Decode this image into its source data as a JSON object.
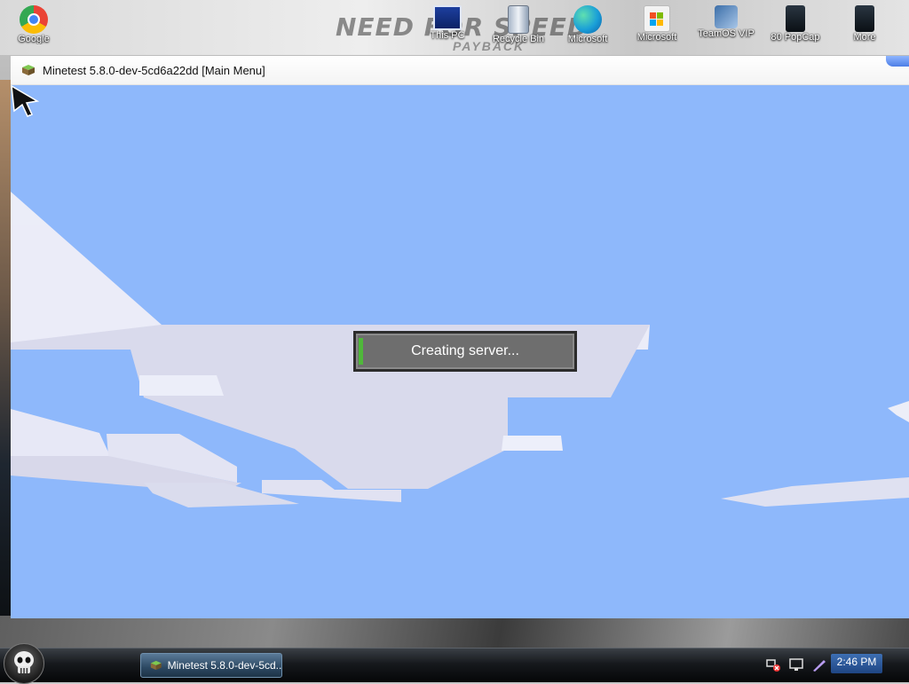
{
  "desktop": {
    "wallpaper_logo": "NEED FOR SPEED",
    "wallpaper_sub": "PAYBACK",
    "icons": [
      {
        "label": "Google",
        "icon": "chrome-icon"
      },
      {
        "label": "This PC",
        "icon": "computer-icon"
      },
      {
        "label": "Recycle Bin",
        "icon": "recycle-bin-icon"
      },
      {
        "label": "Microsoft",
        "icon": "edge-icon"
      },
      {
        "label": "Microsoft",
        "icon": "store-icon"
      },
      {
        "label": "TeamOS VIP",
        "icon": "teamos-icon"
      },
      {
        "label": "80 PopCap",
        "icon": "popcap-icon"
      },
      {
        "label": "More",
        "icon": "more-icon"
      }
    ]
  },
  "window": {
    "title": "Minetest 5.8.0-dev-5cd6a22dd [Main Menu]",
    "progress": {
      "label": "Creating server...",
      "value": 0.02,
      "fill_color": "#4fb83a"
    },
    "sky_color": "#8eb8fb"
  },
  "taskbar": {
    "task_label": "Minetest 5.8.0-dev-5cd...",
    "clock": "2:46 PM"
  }
}
